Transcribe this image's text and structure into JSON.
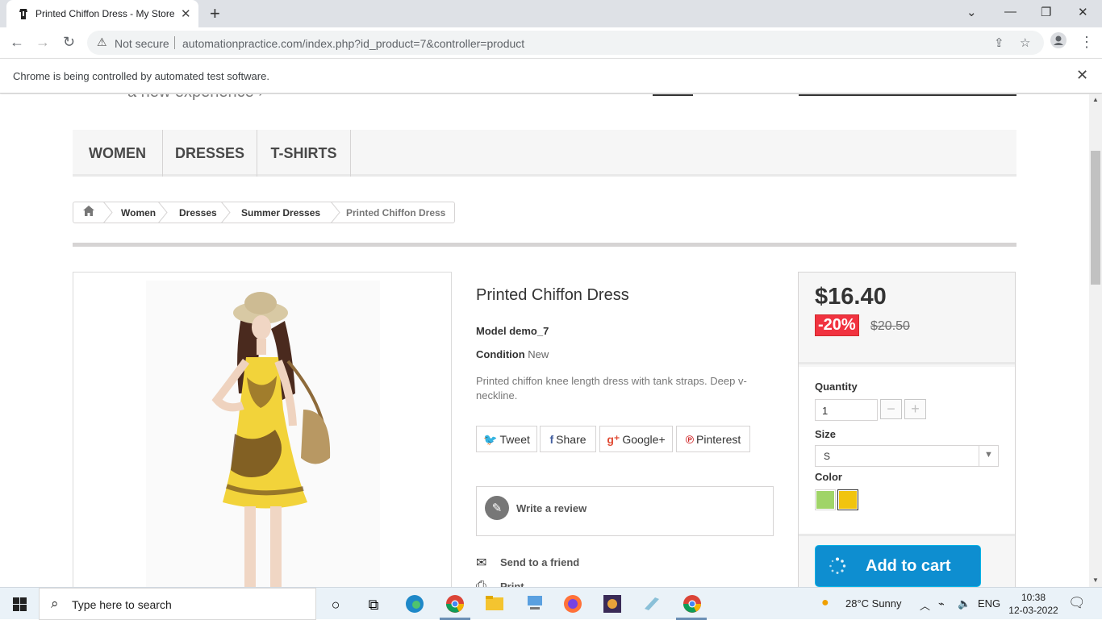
{
  "browser": {
    "tab_title": "Printed Chiffon Dress - My Store",
    "not_secure": "Not secure",
    "url": "automationpractice.com/index.php?id_product=7&controller=product",
    "infobar_message": "Chrome is being controlled by automated test software."
  },
  "page": {
    "partial_banner": "a new experience ›",
    "menu": [
      "WOMEN",
      "DRESSES",
      "T-SHIRTS"
    ],
    "breadcrumb": [
      "Women",
      "Dresses",
      "Summer Dresses",
      "Printed Chiffon Dress"
    ],
    "product": {
      "name": "Printed Chiffon Dress",
      "model_label": "Model",
      "model_value": "demo_7",
      "condition_label": "Condition",
      "condition_value": "New",
      "description": "Printed chiffon knee length dress with tank straps. Deep v-neckline."
    },
    "social": {
      "tweet": "Tweet",
      "share": "Share",
      "google": "Google+",
      "pinterest": "Pinterest"
    },
    "write_review": "Write a review",
    "send_to_friend": "Send to a friend",
    "print": "Print",
    "buy": {
      "price": "$16.40",
      "discount": "-20%",
      "old_price": "$20.50",
      "quantity_label": "Quantity",
      "quantity_value": "1",
      "size_label": "Size",
      "size_value": "S",
      "color_label": "Color",
      "colors": [
        "#a0d468",
        "#f1c40f"
      ],
      "selected_color": 1,
      "add_to_cart": "Add to cart"
    }
  },
  "taskbar": {
    "search_placeholder": "Type here to search",
    "weather": "28°C  Sunny",
    "lang": "ENG",
    "time": "10:38",
    "date": "12-03-2022"
  }
}
